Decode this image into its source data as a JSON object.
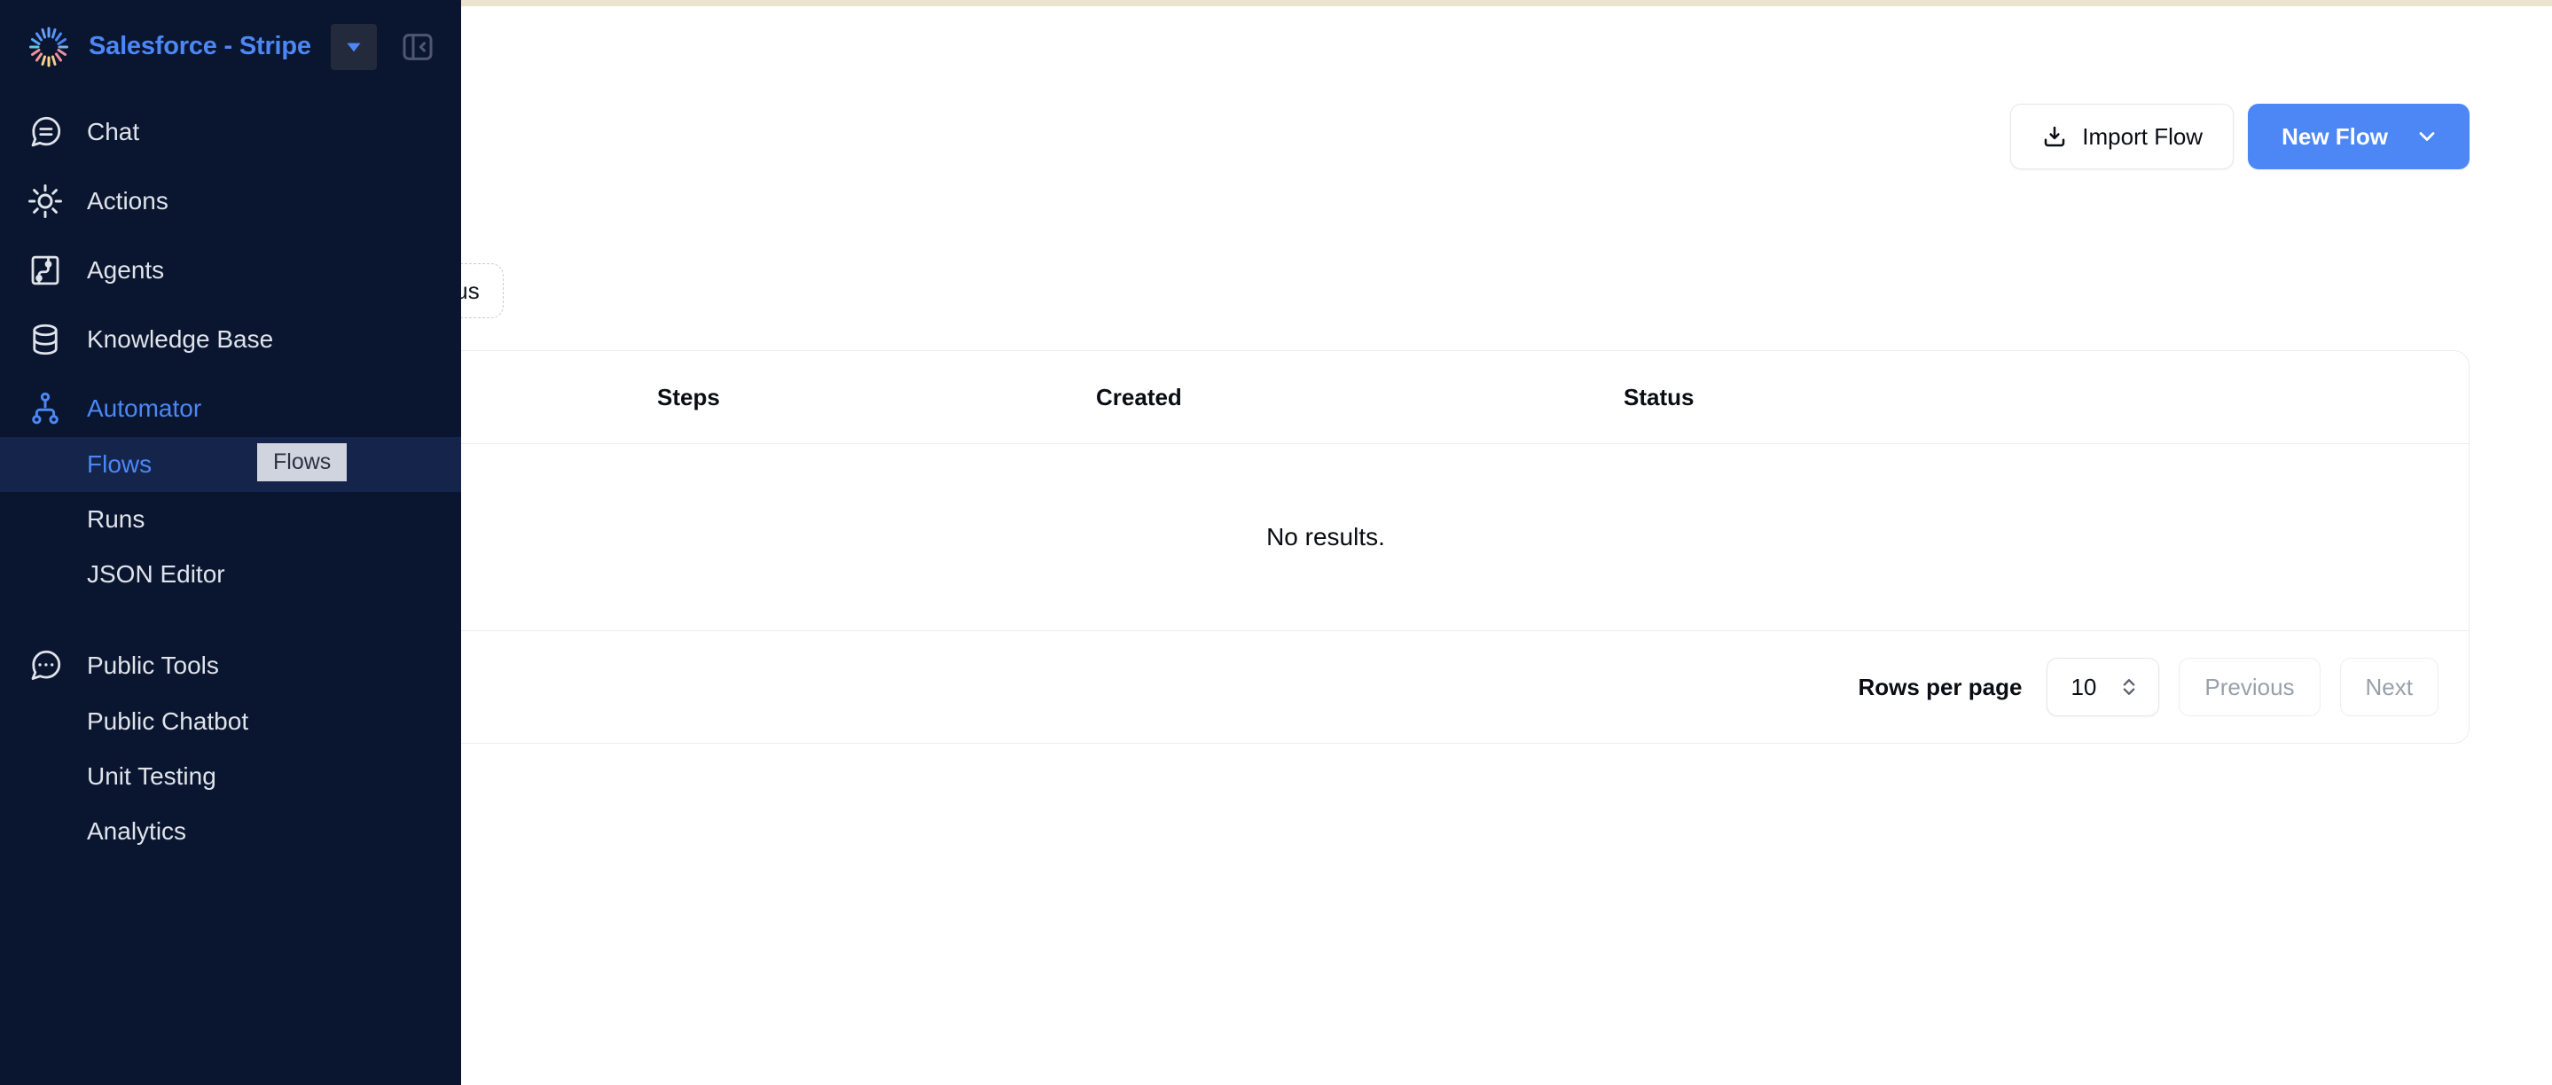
{
  "header": {
    "brand_title": "Salesforce - Stripe",
    "logo_icon": "radial-burst-logo",
    "caret_icon": "caret-down-icon",
    "collapse_icon": "panel-collapse-left-icon"
  },
  "sidebar": {
    "items": [
      {
        "label": "Chat",
        "icon": "chat-bubble-icon",
        "key": "chat"
      },
      {
        "label": "Actions",
        "icon": "gear-sun-icon",
        "key": "actions"
      },
      {
        "label": "Agents",
        "icon": "circuit-board-icon",
        "key": "agents"
      },
      {
        "label": "Knowledge Base",
        "icon": "database-icon",
        "key": "knowledge-base"
      },
      {
        "label": "Automator",
        "icon": "node-tree-icon",
        "key": "automator"
      }
    ],
    "automator_children": [
      {
        "label": "Flows",
        "key": "flows",
        "active": true
      },
      {
        "label": "Runs",
        "key": "runs",
        "active": false
      },
      {
        "label": "JSON Editor",
        "key": "json-editor",
        "active": false
      }
    ],
    "public_tools": {
      "label": "Public Tools",
      "icon": "speech-bubble-dots-icon",
      "key": "public-tools"
    },
    "public_tools_children": [
      {
        "label": "Public Chatbot",
        "key": "public-chatbot"
      },
      {
        "label": "Unit Testing",
        "key": "unit-testing"
      },
      {
        "label": "Analytics",
        "key": "analytics"
      }
    ],
    "tooltip": "Flows"
  },
  "toolbar": {
    "import_label": "Import Flow",
    "import_icon": "download-tray-icon",
    "new_label": "New Flow",
    "new_caret_icon": "chevron-down-icon"
  },
  "filters": {
    "status_chip": "Status"
  },
  "table": {
    "columns": [
      "",
      "Steps",
      "Created",
      "Status"
    ],
    "col_name": "",
    "col_steps": "Steps",
    "col_created": "Created",
    "col_status": "Status",
    "empty_message": "No results.",
    "rows": []
  },
  "pagination": {
    "rows_per_page_label": "Rows per page",
    "rows_per_page_value": "10",
    "stepper_icon": "chevron-up-down-icon",
    "previous_label": "Previous",
    "next_label": "Next"
  },
  "colors": {
    "sidebar_bg": "#0a1630",
    "accent_blue": "#4c87f5",
    "active_item_bg": "#14244a",
    "top_strip": "#ece3cf",
    "border": "#ebecf0",
    "muted_text": "#9aa0ab"
  }
}
